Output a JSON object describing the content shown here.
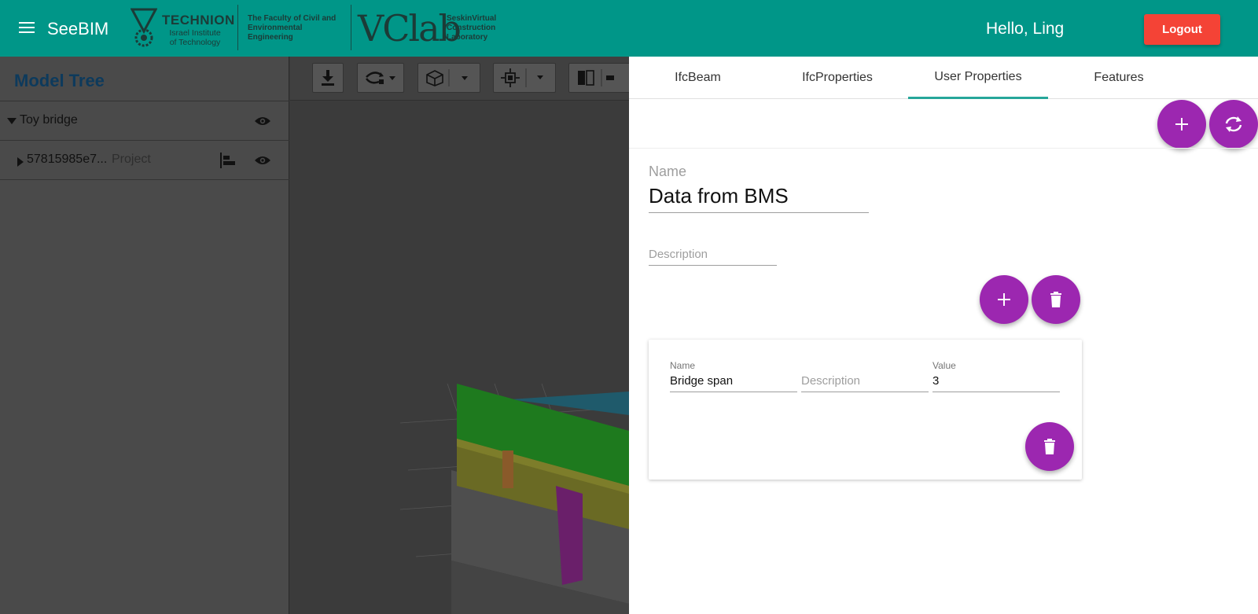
{
  "header": {
    "app_title": "SeeBIM",
    "technion_name": "TECHNION",
    "technion_sub": "Israel Institute of Technology",
    "faculty": "The Faculty of Civil and Environmental Engineering",
    "vclab": "VClab",
    "vclab_sub": "SeskinVirtual Construction Laboratory",
    "greeting": "Hello, Ling",
    "logout_label": "Logout",
    "brand_color": "#009688",
    "logout_color": "#f44336"
  },
  "model_tree": {
    "title": "Model Tree",
    "items": [
      {
        "label": "Toy bridge",
        "sub": ""
      },
      {
        "label": "57815985e7...",
        "sub": "Project"
      }
    ]
  },
  "panel": {
    "tabs": [
      {
        "label": "IfcBeam"
      },
      {
        "label": "IfcProperties"
      },
      {
        "label": "User Properties"
      },
      {
        "label": "Features"
      }
    ],
    "active_tab": "User Properties",
    "accent_color": "#9c27b0",
    "propset": {
      "name_label": "Name",
      "name_value": "Data from BMS",
      "description_placeholder": "Description"
    },
    "property": {
      "name_label": "Name",
      "name_value": "Bridge span",
      "description_placeholder": "Description",
      "value_label": "Value",
      "value_value": "3"
    }
  }
}
